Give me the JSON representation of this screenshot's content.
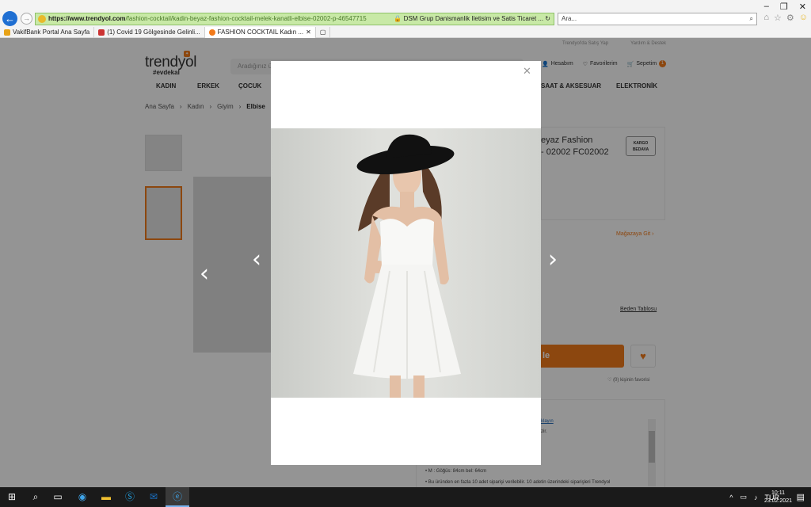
{
  "browser": {
    "url_host": "https://www.trendyol.com",
    "url_path": "/fashion-cocktail/kadin-beyaz-fashion-cocktail-melek-kanatli-elbise-02002-p-46547715",
    "cert_label": "DSM Grup Danismanlik Iletisim ve Satis Ticaret ...",
    "search_placeholder": "Ara...",
    "tabs": [
      {
        "label": "VakifBank Portal Ana Sayfa",
        "color": "#e8a317"
      },
      {
        "label": "(1) Covid 19 Gölgesinde Gelinli...",
        "color": "#c33"
      },
      {
        "label": "FASHION COCKTAIL Kadın ...",
        "color": "#f27a1a"
      }
    ]
  },
  "site": {
    "logo": "trendyol",
    "logo_sub": "#evdekal",
    "search_placeholder": "Aradığınız ü",
    "top_links": [
      "Trendyol'da Satış Yap",
      "Yardım & Destek"
    ],
    "account_label": "Hesabım",
    "favorites_label": "Favorilerim",
    "cart_label": "Sepetim",
    "cart_count": "1",
    "nav": [
      "KADIN",
      "ERKEK",
      "ÇOCUK",
      "SAAT & AKSESUAR",
      "ELEKTRONİK"
    ],
    "breadcrumb": [
      "Ana Sayfa",
      "Kadın",
      "Giyim",
      "Elbise"
    ],
    "product_title_line1": "eyaz Fashion",
    "product_title_line2": "- 02002 FC02002",
    "kargo_line1": "KARGO",
    "kargo_line2": "BEDAVA",
    "store_link": "Mağazaya Git",
    "size_chart": "Beden Tablosu",
    "add_to_cart": "le",
    "favorite_count": "(0) kişinin favorisi",
    "details": [
      "klayın",
      "zir.",
      "M : Göğüs: 84cm bel: 64cm",
      "Bu üründen en fazla 10 adet siparişi verilebilir. 10 adetin üzerindeki siparişleri Trendyol"
    ]
  },
  "taskbar": {
    "lang": "TUR",
    "time": "10:11",
    "date": "23.02.2021"
  },
  "colors": {
    "brand": "#f27a1a",
    "url_bar": "#c8e9a6",
    "taskbar": "#1a1a1a"
  }
}
